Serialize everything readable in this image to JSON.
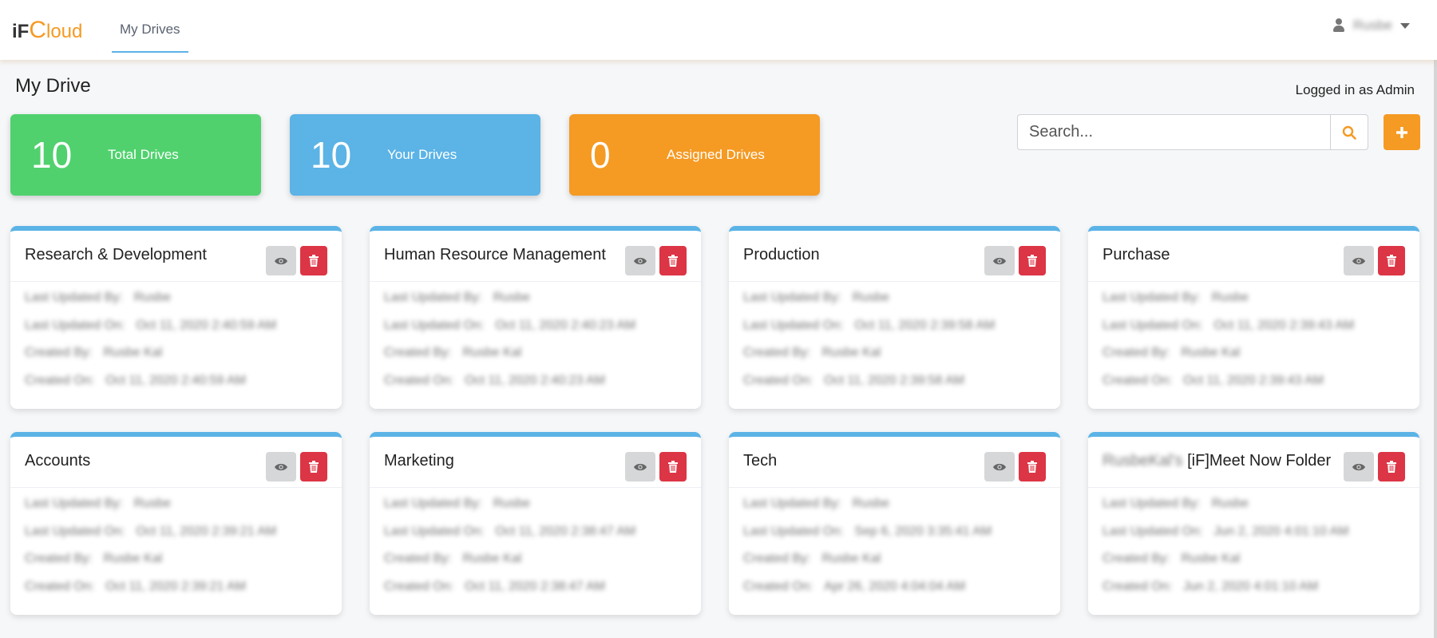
{
  "header": {
    "logo": {
      "part1": "iF",
      "part2": "C",
      "part3": "loud"
    },
    "nav_tab": "My Drives",
    "user_name": "Rusbe"
  },
  "page": {
    "title": "My Drive",
    "logged_in": "Logged in as Admin"
  },
  "stats": [
    {
      "value": "10",
      "label": "Total Drives",
      "color": "#50d16e"
    },
    {
      "value": "10",
      "label": "Your Drives",
      "color": "#5bb3e6"
    },
    {
      "value": "0",
      "label": "Assigned Drives",
      "color": "#f59a23"
    }
  ],
  "search": {
    "placeholder": "Search..."
  },
  "meta_labels": {
    "last_updated_by": "Last Updated By:",
    "last_updated_on": "Last Updated On:",
    "created_by": "Created By:",
    "created_on": "Created On:"
  },
  "drives": [
    {
      "title_prefix": "",
      "title": "Research & Development",
      "last_updated_by": "Rusbe",
      "last_updated_on": "Oct 11, 2020 2:40:59 AM",
      "created_by": "Rusbe Kal",
      "created_on": "Oct 11, 2020 2:40:59 AM"
    },
    {
      "title_prefix": "",
      "title": "Human Resource Management",
      "last_updated_by": "Rusbe",
      "last_updated_on": "Oct 11, 2020 2:40:23 AM",
      "created_by": "Rusbe Kal",
      "created_on": "Oct 11, 2020 2:40:23 AM"
    },
    {
      "title_prefix": "",
      "title": "Production",
      "last_updated_by": "Rusbe",
      "last_updated_on": "Oct 11, 2020 2:39:58 AM",
      "created_by": "Rusbe Kal",
      "created_on": "Oct 11, 2020 2:39:58 AM"
    },
    {
      "title_prefix": "",
      "title": "Purchase",
      "last_updated_by": "Rusbe",
      "last_updated_on": "Oct 11, 2020 2:39:43 AM",
      "created_by": "Rusbe Kal",
      "created_on": "Oct 11, 2020 2:39:43 AM"
    },
    {
      "title_prefix": "",
      "title": "Accounts",
      "last_updated_by": "Rusbe",
      "last_updated_on": "Oct 11, 2020 2:39:21 AM",
      "created_by": "Rusbe Kal",
      "created_on": "Oct 11, 2020 2:39:21 AM"
    },
    {
      "title_prefix": "",
      "title": "Marketing",
      "last_updated_by": "Rusbe",
      "last_updated_on": "Oct 11, 2020 2:38:47 AM",
      "created_by": "Rusbe Kal",
      "created_on": "Oct 11, 2020 2:38:47 AM"
    },
    {
      "title_prefix": "",
      "title": "Tech",
      "last_updated_by": "Rusbe",
      "last_updated_on": "Sep 6, 2020 3:35:41 AM",
      "created_by": "Rusbe Kal",
      "created_on": "Apr 26, 2020 4:04:04 AM"
    },
    {
      "title_prefix": "RusbeKal's",
      "title": "[iF]Meet Now Folder",
      "last_updated_by": "Rusbe",
      "last_updated_on": "Jun 2, 2020 4:01:10 AM",
      "created_by": "Rusbe Kal",
      "created_on": "Jun 2, 2020 4:01:10 AM"
    }
  ],
  "icons": {
    "search": "search-icon",
    "add": "plus-icon",
    "view": "eye-icon",
    "delete": "trash-icon",
    "user": "user-icon",
    "caret": "caret-down-icon"
  }
}
